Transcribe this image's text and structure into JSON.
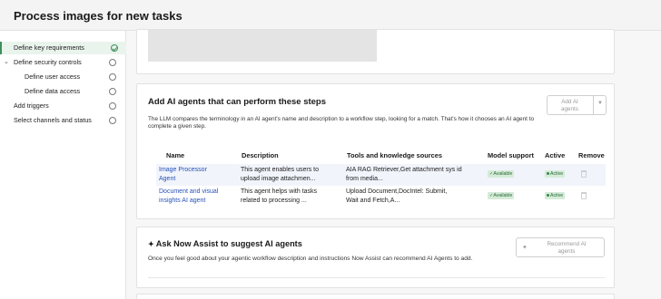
{
  "header": {
    "title": "Process images for new tasks"
  },
  "sidebar": {
    "items": [
      {
        "label": "Define key requirements",
        "status": "complete",
        "active": true
      },
      {
        "label": "Define security controls",
        "status": "pending",
        "expanded": true
      },
      {
        "label": "Define user access",
        "status": "pending"
      },
      {
        "label": "Define data access",
        "status": "pending"
      },
      {
        "label": "Add triggers",
        "status": "pending"
      },
      {
        "label": "Select channels and status",
        "status": "pending"
      }
    ]
  },
  "agents_section": {
    "title": "Add AI agents that can perform these steps",
    "add_button": "Add AI\nagents",
    "description": "The LLM compares the terminology in an AI agent's name and description to a workflow step, looking for a match. That's how it chooses an AI agent to complete a given step.",
    "columns": [
      "Name",
      "Description",
      "Tools and knowledge sources",
      "Model support",
      "Active",
      "Remove"
    ],
    "rows": [
      {
        "name": "Image Processor\nAgent",
        "description": "This agent enables users to\nupload image attachmen...",
        "tools": "AIA RAG Retriever,Get attachment sys id\nfrom media...",
        "model_support": "Available",
        "active": "Active"
      },
      {
        "name": "Document and visual\ninsights AI agent",
        "description": "This agent helps with tasks\nrelated to processing ...",
        "tools": "Upload Document,DocIntel: Submit,\nWait and Fetch,A...",
        "model_support": "Available",
        "active": "Active"
      }
    ]
  },
  "suggest_section": {
    "title": "Ask Now Assist to suggest AI agents",
    "description": "Once you feel good about your agentic workflow description and instructions Now Assist can recommend AI Agents to add.",
    "recommend_button": "Recommend AI\nagents"
  },
  "colors": {
    "accent": "#3d8f5b",
    "link": "#2552b8",
    "badge_bg": "#d5ebd8"
  }
}
